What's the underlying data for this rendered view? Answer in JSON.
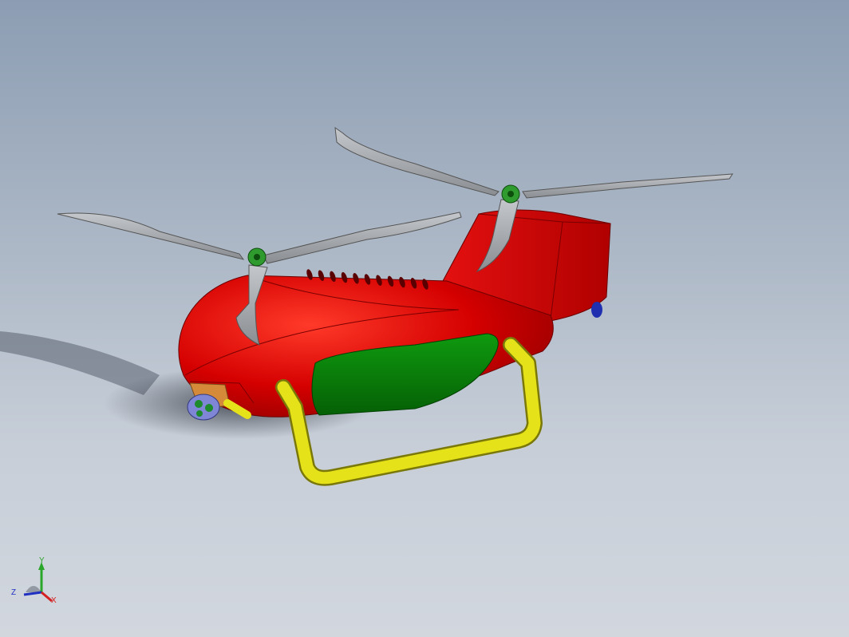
{
  "viewport": {
    "background_top": "#8c9db3",
    "background_bottom": "#d2d7de"
  },
  "model": {
    "fuselage_color": "#d40000",
    "side_panel_color": "#0a7d0a",
    "landing_skid_color": "#e6e21a",
    "rotor_blade_color": "#a6a9ad",
    "rotor_hub_color": "#2f9b2f",
    "camera_pod_color": "#d58a3a",
    "camera_lens_color": "#7f86d6",
    "tail_light_color": "#1f2fb0",
    "rotor_count": 2,
    "blades_per_rotor": 3,
    "vent_slot_count": 11
  },
  "triad": {
    "x_label": "X",
    "y_label": "Y",
    "z_label": "Z",
    "x_color": "#d42020",
    "y_color": "#2aa62a",
    "z_color": "#2030c0"
  }
}
